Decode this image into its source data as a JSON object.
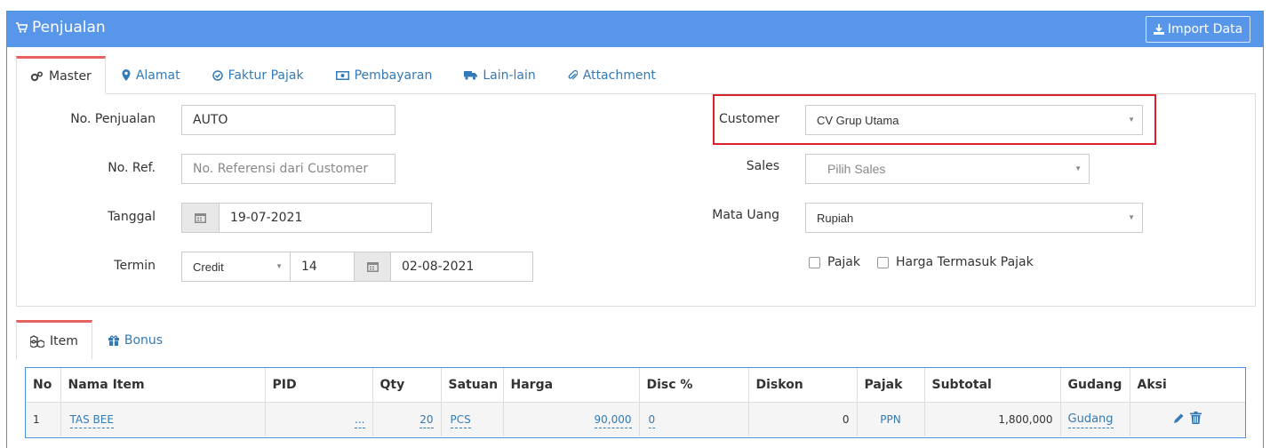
{
  "header": {
    "title": "Penjualan",
    "import_label": "Import Data"
  },
  "tabs": [
    {
      "label": "Master",
      "icon": "gears-icon"
    },
    {
      "label": "Alamat",
      "icon": "map-marker-icon"
    },
    {
      "label": "Faktur Pajak",
      "icon": "check-circle-icon"
    },
    {
      "label": "Pembayaran",
      "icon": "money-icon"
    },
    {
      "label": "Lain-lain",
      "icon": "truck-icon"
    },
    {
      "label": "Attachment",
      "icon": "paperclip-icon"
    }
  ],
  "form": {
    "no_penjualan": {
      "label": "No. Penjualan",
      "value": "AUTO"
    },
    "no_ref": {
      "label": "No. Ref.",
      "placeholder": "No. Referensi dari Customer"
    },
    "tanggal": {
      "label": "Tanggal",
      "value": "19-07-2021"
    },
    "termin": {
      "label": "Termin",
      "type_value": "Credit",
      "days": "14",
      "due_date": "02-08-2021"
    },
    "customer": {
      "label": "Customer",
      "value": "CV Grup Utama"
    },
    "sales": {
      "label": "Sales",
      "placeholder": "Pilih Sales"
    },
    "mata_uang": {
      "label": "Mata Uang",
      "value": "Rupiah"
    },
    "pajak_label": "Pajak",
    "harga_termasuk_pajak_label": "Harga Termasuk Pajak"
  },
  "item_tabs": [
    {
      "label": "Item",
      "icon": "cubes-icon"
    },
    {
      "label": "Bonus",
      "icon": "gift-icon"
    }
  ],
  "table": {
    "headers": [
      "No",
      "Nama Item",
      "PID",
      "Qty",
      "Satuan",
      "Harga",
      "Disc %",
      "Diskon",
      "Pajak",
      "Subtotal",
      "Gudang",
      "Aksi"
    ],
    "rows": [
      {
        "no": "1",
        "nama": "TAS BEE",
        "pid": "...",
        "qty": "20",
        "satuan": "PCS",
        "harga": "90,000",
        "disc": "0",
        "diskon": "0",
        "pajak": "PPN",
        "subtotal": "1,800,000",
        "gudang": "Gudang"
      }
    ]
  },
  "colors": {
    "header_bg": "#5796e9",
    "accent": "#337ab7",
    "highlight": "#d9232c",
    "active_tab_border": "#e86161"
  }
}
